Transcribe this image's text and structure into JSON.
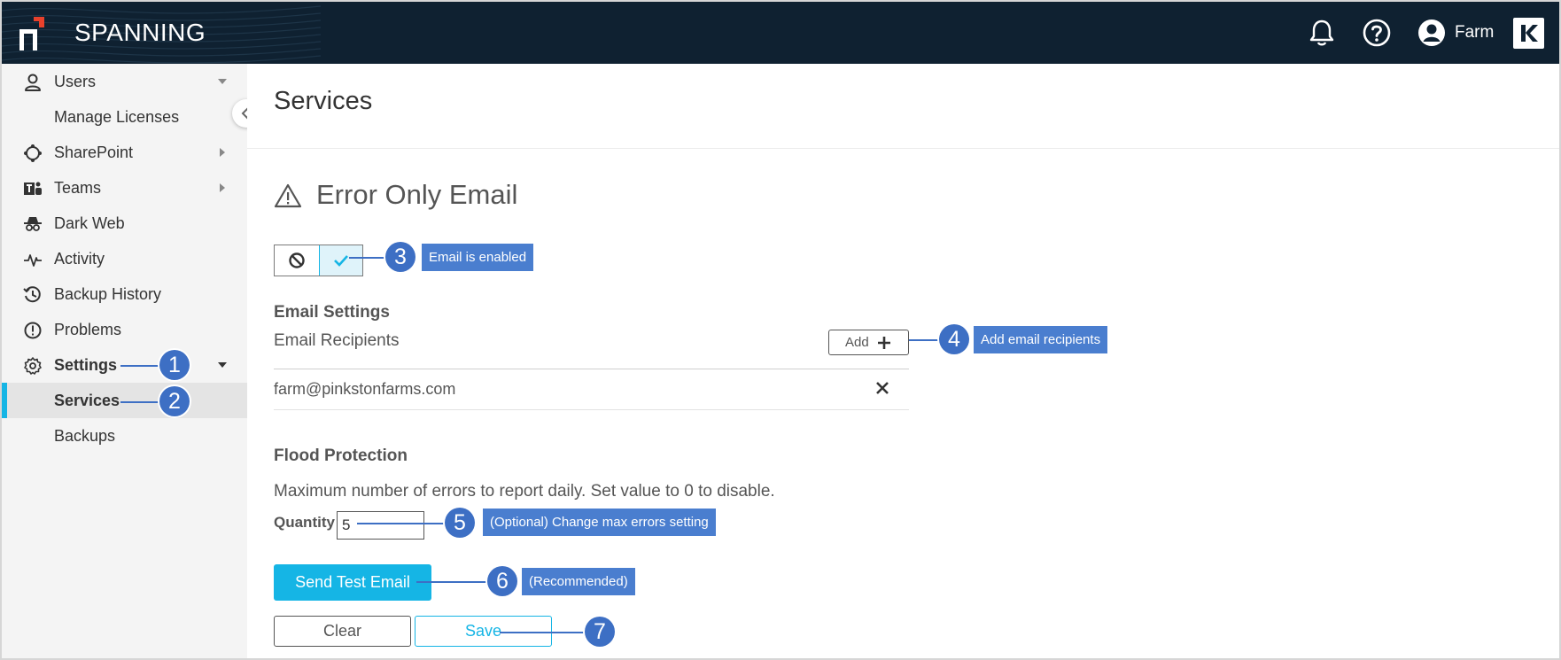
{
  "header": {
    "brand": "SPANNING",
    "user_name": "Farm",
    "icons": [
      "bell-icon",
      "help-icon",
      "user-avatar-icon",
      "kaseya-logo"
    ]
  },
  "sidebar": {
    "items": [
      {
        "label": "Users",
        "icon": "user-icon",
        "caret": "down"
      },
      {
        "label": "Manage Licenses"
      },
      {
        "label": "SharePoint",
        "icon": "sharepoint-icon",
        "caret": "right"
      },
      {
        "label": "Teams",
        "icon": "teams-icon",
        "caret": "right"
      },
      {
        "label": "Dark Web",
        "icon": "spy-icon"
      },
      {
        "label": "Activity",
        "icon": "activity-icon"
      },
      {
        "label": "Backup History",
        "icon": "history-icon"
      },
      {
        "label": "Problems",
        "icon": "alert-circle-icon"
      },
      {
        "label": "Settings",
        "icon": "gear-icon",
        "caret": "down"
      },
      {
        "label": "Services"
      },
      {
        "label": "Backups"
      }
    ]
  },
  "main": {
    "page_title": "Services",
    "section_title": "Error Only Email",
    "email_settings_heading": "Email Settings",
    "recipients_label": "Email Recipients",
    "add_label": "Add",
    "recipient_email": "farm@pinkstonfarms.com",
    "flood_heading": "Flood Protection",
    "flood_description": "Maximum number of errors to report daily. Set value to 0 to disable.",
    "quantity_label": "Quantity",
    "quantity_value": "5",
    "send_test_label": "Send Test Email",
    "clear_label": "Clear",
    "save_label": "Save"
  },
  "annotations": [
    {
      "number": "1"
    },
    {
      "number": "2"
    },
    {
      "number": "3",
      "label": "Email is enabled"
    },
    {
      "number": "4",
      "label": "Add email recipients"
    },
    {
      "number": "5",
      "label": "(Optional) Change max errors setting"
    },
    {
      "number": "6",
      "label": "(Recommended)"
    },
    {
      "number": "7"
    }
  ],
  "colors": {
    "header_bg": "#0f2131",
    "accent": "#15b5e5",
    "annotation": "#3d6fc4",
    "logo_red": "#e8412c"
  }
}
